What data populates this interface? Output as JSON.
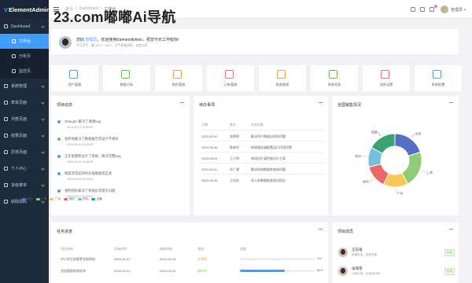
{
  "app": {
    "title": "ElementAdmin"
  },
  "watermark": "23.com嘟嘟Ai导航",
  "sidebar": {
    "items": [
      {
        "label": "Dashboard",
        "type": "group"
      },
      {
        "label": "工作台",
        "type": "sub",
        "active": true
      },
      {
        "label": "分析页",
        "type": "sub"
      },
      {
        "label": "监控页",
        "type": "sub"
      },
      {
        "label": "系统管理",
        "type": "group"
      },
      {
        "label": "表单页面",
        "type": "group"
      },
      {
        "label": "列表页面",
        "type": "group"
      },
      {
        "label": "结果页面",
        "type": "group"
      },
      {
        "label": "异常页面",
        "type": "group"
      },
      {
        "label": "个人中心",
        "type": "group"
      },
      {
        "label": "多级菜单",
        "type": "group"
      },
      {
        "label": "获取源码",
        "type": "group"
      }
    ]
  },
  "header": {
    "breadcrumb": [
      "首页",
      "/",
      "Dashboard",
      "/",
      "工作台"
    ],
    "notification_count": "8",
    "user_name": "管理员"
  },
  "welcome": {
    "greeting_prefix": "您好,",
    "user": "管理员",
    "greeting_suffix": "，欢迎使用ElementAdmin，祝您今天工作愉快!",
    "sub": "今日天气：晴 18°C ~ 26°C，空气质量良好，适宜出行"
  },
  "quick_links": [
    {
      "label": "用户管理",
      "color": "#409eff"
    },
    {
      "label": "数据分析",
      "color": "#67c23a"
    },
    {
      "label": "角色管理",
      "color": "#e6a23c"
    },
    {
      "label": "订单管理",
      "color": "#f56c6c"
    },
    {
      "label": "报表图表",
      "color": "#e6a23c"
    },
    {
      "label": "系统消息",
      "color": "#67c23a"
    },
    {
      "label": "消息设置",
      "color": "#f56c6c"
    },
    {
      "label": "系统配置",
      "color": "#409eff"
    }
  ],
  "dynamics": {
    "title": "项目动态",
    "items": [
      {
        "text": "zhanghe 解决了重要bug",
        "date": "2023-05-11 10:30:00",
        "color": "#409eff"
      },
      {
        "text": "张伟协解决了数据报告库设计不相符",
        "date": "2023-05-10 15:20:00",
        "color": "#67c23a"
      },
      {
        "text": "王军张重新设计了系统：解决完整bug",
        "date": "2023-05-09 11:45:00",
        "color": "#409eff"
      },
      {
        "text": "谢昊哥完成项目开发数据等正式",
        "date": "2023-05-08 09:15:00",
        "color": "#409eff"
      },
      {
        "text": "张明团队解决了系统异常提示问题",
        "date": "2023-05-07 16:40:00",
        "color": "#409eff"
      }
    ]
  },
  "todo": {
    "title": "待办事项",
    "headers": [
      "日期",
      "姓名",
      "任务内容"
    ],
    "rows": [
      [
        "2023-05-09",
        "张明明",
        "解决用户数据出现的问题"
      ],
      [
        "2023-05-08",
        "陈新利",
        "修改服务器配置运行环境设置"
      ],
      [
        "2023-05-04",
        "王小明",
        "修改后扩展性能设计方案"
      ],
      [
        "2023-05-01",
        "孙广通",
        "解决系统数据库查询问题"
      ],
      [
        "2023-05-08",
        "王佳怡",
        "导入新数据批量测试报告"
      ]
    ]
  },
  "sales": {
    "title": "全国销售情况",
    "legend": [
      "北京",
      "上海",
      "广州",
      "深圳",
      "杭州",
      "成都"
    ]
  },
  "chart_data": {
    "type": "pie",
    "title": "全国销售情况",
    "categories": [
      "北京",
      "上海",
      "广州",
      "深圳",
      "杭州",
      "成都"
    ],
    "values": [
      20,
      22,
      15,
      14,
      12,
      17
    ],
    "colors": [
      "#5470c6",
      "#91cc75",
      "#fac858",
      "#ee6666",
      "#73c0de",
      "#3ba272"
    ],
    "donut": true
  },
  "tasks": {
    "title": "任务进度",
    "headers": [
      "项目名称",
      "开始时间",
      "结束时间",
      "状态",
      "进度"
    ],
    "rows": [
      {
        "name": "中小学生创意等学校研创",
        "start": "2022-01-01",
        "end": "2022-01-31",
        "status": "未完成",
        "progress": 0.0,
        "progress_label": "0%",
        "status_color": "#e6a23c"
      },
      {
        "name": "文档管理系统发布",
        "start": "2022-02-01",
        "end": "2022-03-31",
        "status": "进行中",
        "progress": 0.6,
        "progress_label": "60%",
        "status_color": "#67c23a"
      }
    ]
  },
  "team": {
    "title": "项目成员",
    "members": [
      {
        "name": "王志强",
        "role": "前端开发，技术专家",
        "status": "在线"
      },
      {
        "name": "张瑞雪",
        "role": "UI设计师，交互设计师",
        "status": "在线"
      }
    ]
  }
}
